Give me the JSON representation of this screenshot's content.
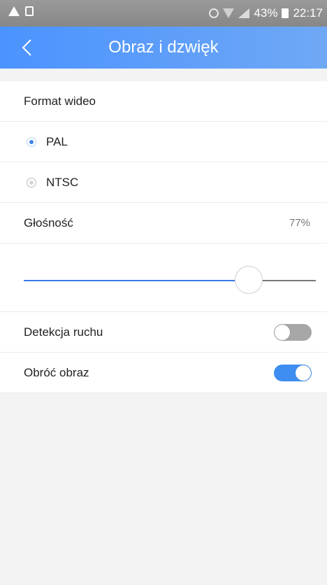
{
  "status_bar": {
    "battery": "43%",
    "time": "22:17",
    "icons": [
      "warning-icon",
      "image-icon",
      "alarm-icon",
      "wifi-icon",
      "signal-icon",
      "battery-icon"
    ]
  },
  "app_bar": {
    "title": "Obraz i dzwięk",
    "back_icon": "chevron-left-icon"
  },
  "settings": {
    "video_format": {
      "label": "Format wideo",
      "options": [
        {
          "label": "PAL",
          "selected": true
        },
        {
          "label": "NTSC",
          "selected": false
        }
      ]
    },
    "volume": {
      "label": "Głośność",
      "value_text": "77%",
      "value": 77
    },
    "motion_detection": {
      "label": "Detekcja ruchu",
      "enabled": false
    },
    "rotate_image": {
      "label": "Obróć obraz",
      "enabled": true
    }
  },
  "colors": {
    "accent": "#3d8ef0",
    "app_bar": "#5a9cf8",
    "background": "#f3f3f3"
  }
}
